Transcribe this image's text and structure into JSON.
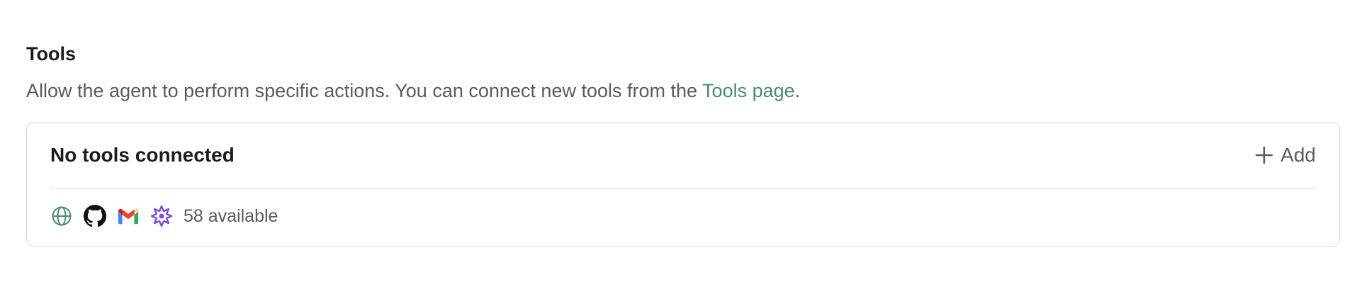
{
  "tools_section": {
    "title": "Tools",
    "description_prefix": "Allow the agent to perform specific actions. You can connect new tools from the ",
    "description_link": "Tools page",
    "description_suffix": ".",
    "link_color": "#4a8a73"
  },
  "tools_card": {
    "title": "No tools connected",
    "add_label": "Add",
    "available_text": "58 available",
    "icons": [
      "globe-icon",
      "github-icon",
      "gmail-icon",
      "sparkle-badge-icon"
    ]
  }
}
